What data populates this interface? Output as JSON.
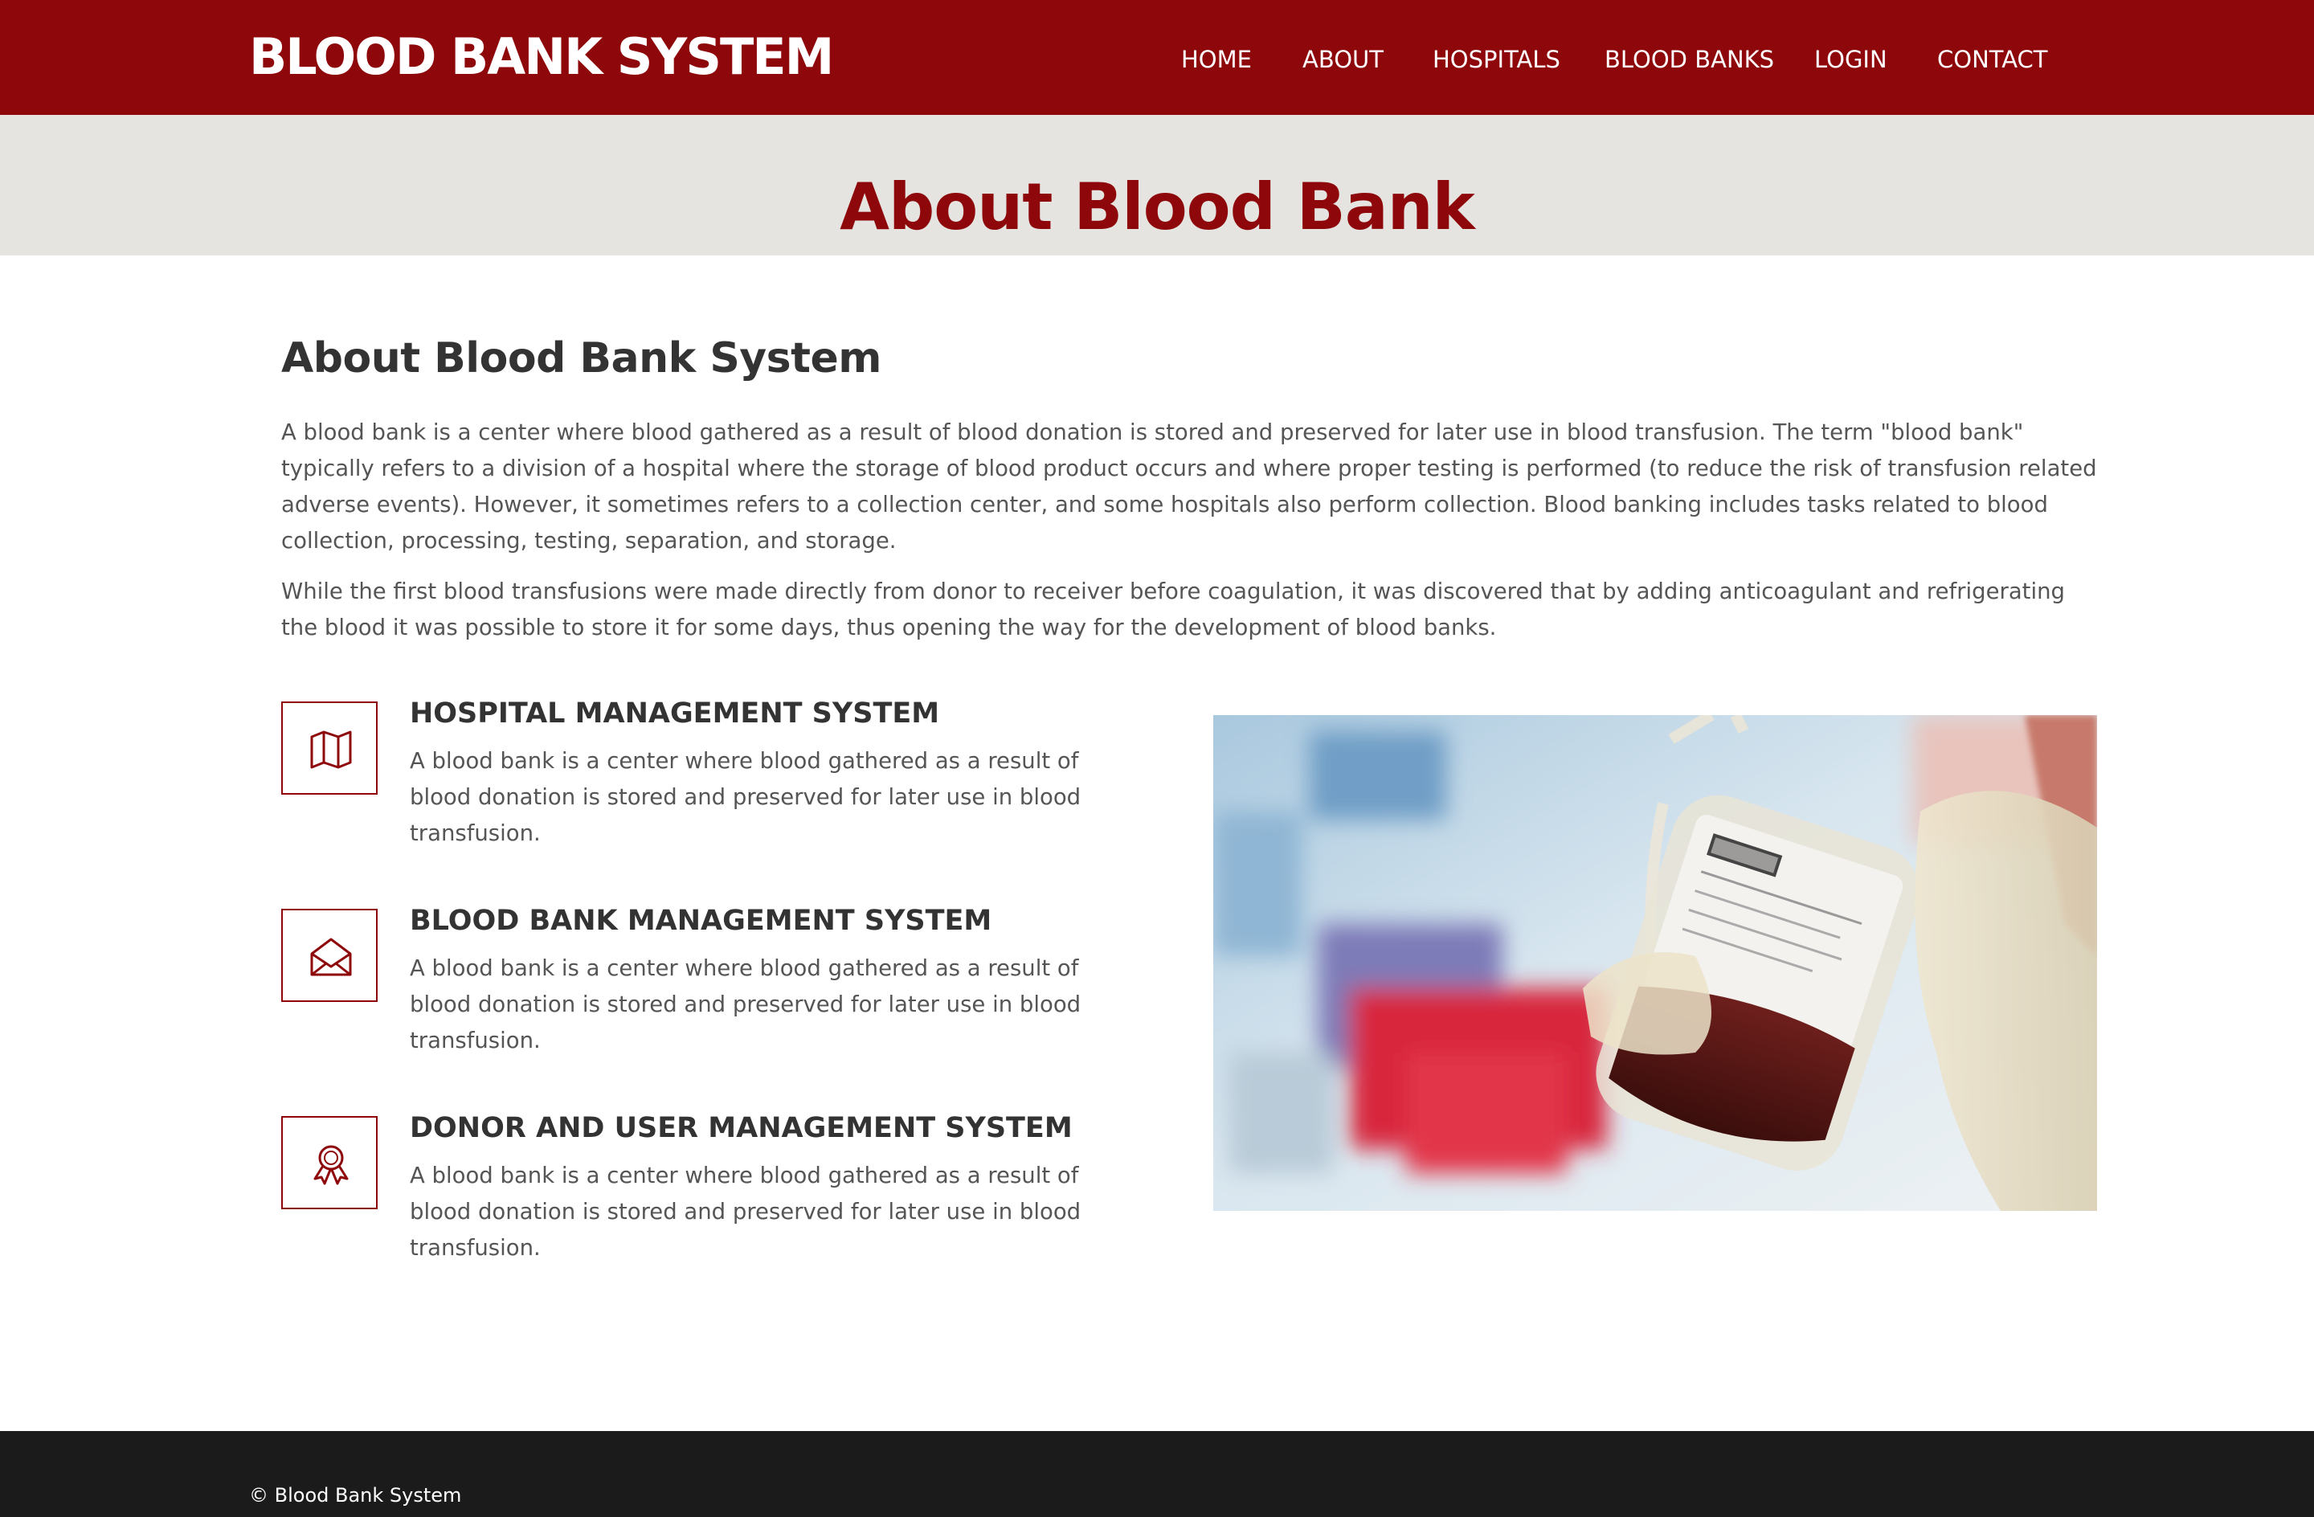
{
  "header": {
    "brand": "BLOOD BANK SYSTEM",
    "nav": [
      "HOME",
      "ABOUT",
      "HOSPITALS",
      "BLOOD BANKS",
      "LOGIN",
      "CONTACT"
    ]
  },
  "banner": {
    "title": "About Blood Bank"
  },
  "about": {
    "heading": "About Blood Bank System",
    "paragraphs": [
      "A blood bank is a center where blood gathered as a result of blood donation is stored and preserved for later use in blood transfusion. The term \"blood bank\" typically refers to a division of a hospital where the storage of blood product occurs and where proper testing is performed (to reduce the risk of transfusion related adverse events). However, it sometimes refers to a collection center, and some hospitals also perform collection. Blood banking includes tasks related to blood collection, processing, testing, separation, and storage.",
      "While the first blood transfusions were made directly from donor to receiver before coagulation, it was discovered that by adding anticoagulant and refrigerating the blood it was possible to store it for some days, thus opening the way for the development of blood banks."
    ]
  },
  "features": [
    {
      "icon": "map-icon",
      "title": "HOSPITAL MANAGEMENT SYSTEM",
      "text": "A blood bank is a center where blood gathered as a result of blood donation is stored and preserved for later use in blood transfusion."
    },
    {
      "icon": "envelope-open-icon",
      "title": "BLOOD BANK MANAGEMENT SYSTEM",
      "text": "A blood bank is a center where blood gathered as a result of blood donation is stored and preserved for later use in blood transfusion."
    },
    {
      "icon": "award-icon",
      "title": "DONOR AND USER MANAGEMENT SYSTEM",
      "text": "A blood bank is a center where blood gathered as a result of blood donation is stored and preserved for later use in blood transfusion."
    }
  ],
  "footer": {
    "copyright": "© Blood Bank System"
  },
  "colors": {
    "brand": "#8e080b",
    "band": "#e5e4e0",
    "footer": "#1b1b1b"
  }
}
